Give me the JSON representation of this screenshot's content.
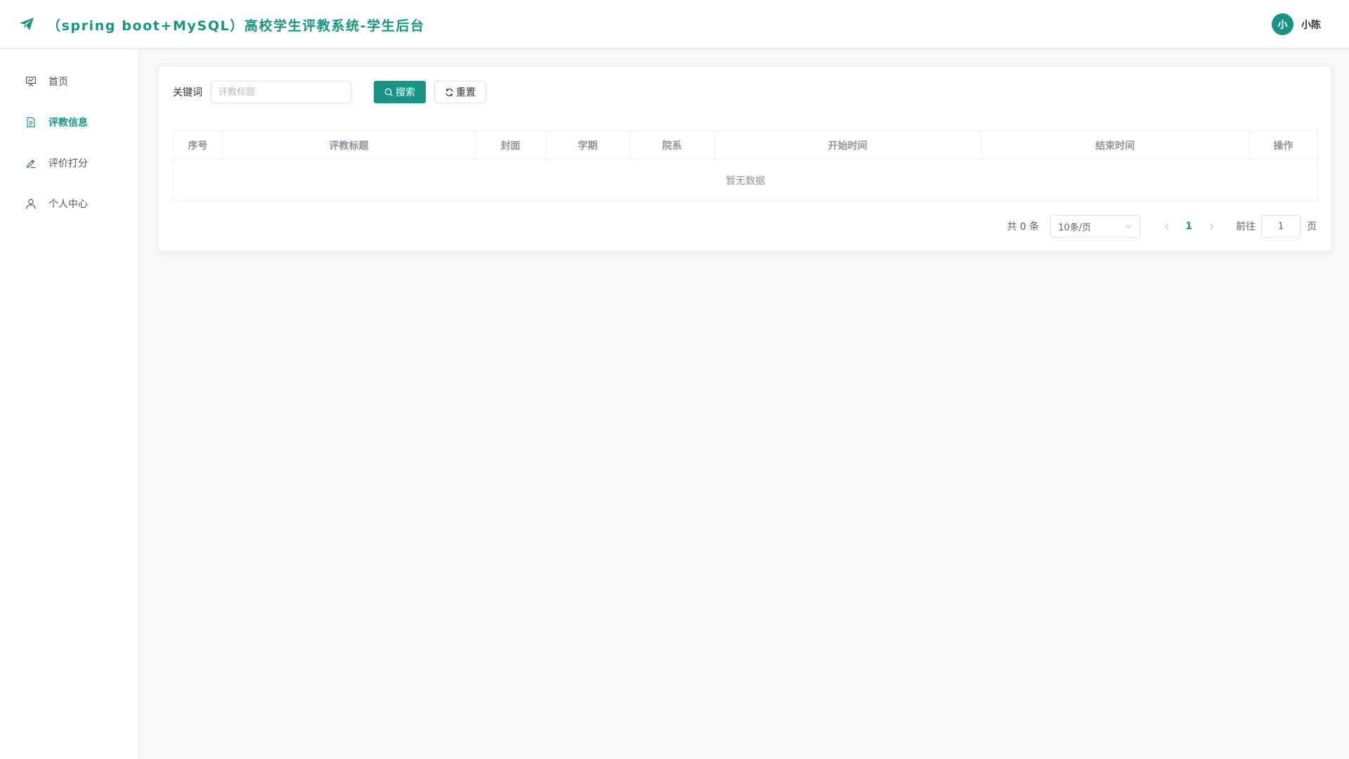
{
  "app": {
    "title": "（spring boot+MySQL）高校学生评教系统-学生后台",
    "brand_color": "#199484"
  },
  "user": {
    "avatar_text": "小",
    "name": "小陈"
  },
  "sidebar": {
    "items": [
      {
        "label": "首页",
        "icon": "presentation-icon",
        "active": false
      },
      {
        "label": "评教信息",
        "icon": "document-icon",
        "active": true
      },
      {
        "label": "评价打分",
        "icon": "pen-icon",
        "active": false
      },
      {
        "label": "个人中心",
        "icon": "user-icon",
        "active": false
      }
    ]
  },
  "search": {
    "label": "关键词",
    "placeholder": "评教标题",
    "value": "",
    "search_button": "搜索",
    "reset_button": "重置"
  },
  "table": {
    "columns": [
      "序号",
      "评教标题",
      "封面",
      "学期",
      "院系",
      "开始时间",
      "结束时间",
      "操作"
    ],
    "rows": [],
    "empty_text": "暂无数据"
  },
  "pagination": {
    "total_text": "共 0 条",
    "page_size": "10条/页",
    "current_page": "1",
    "goto_label": "前往",
    "goto_value": "1",
    "page_suffix": "页"
  }
}
